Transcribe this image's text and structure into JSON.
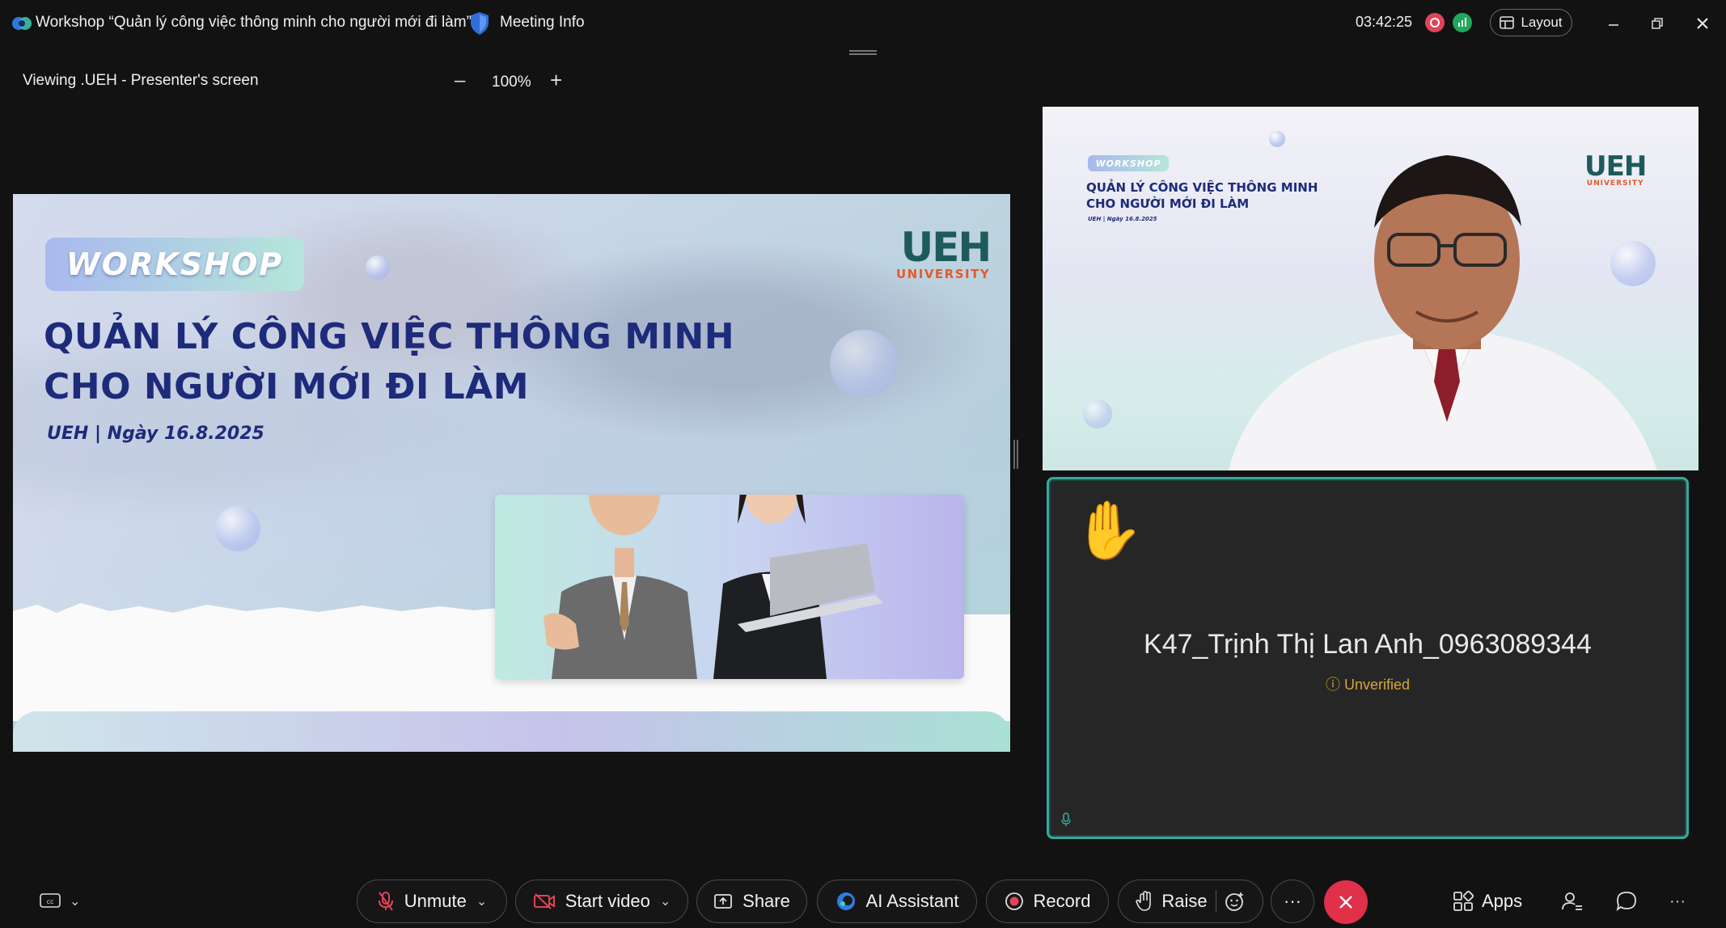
{
  "titlebar": {
    "meeting_title": "Workshop “Quản lý công việc thông minh cho người mới đi làm”",
    "meeting_info_label": "Meeting Info",
    "timer": "03:42:25",
    "layout_label": "Layout"
  },
  "viewbar": {
    "viewing_label": "Viewing .UEH - Presenter's screen",
    "zoom_level": "100%",
    "zoom_out": "–",
    "zoom_in": "+"
  },
  "slide": {
    "tag": "WORKSHOP",
    "title_line1": "QUẢN LÝ CÔNG VIỆC THÔNG MINH",
    "title_line2": "CHO NGƯỜI MỚI ĐI LÀM",
    "date": "UEH | Ngày 16.8.2025",
    "logo_main": "UEH",
    "logo_sub": "UNIVERSITY"
  },
  "webcam": {
    "tag": "WORKSHOP",
    "title_line1": "QUẢN LÝ CÔNG VIỆC THÔNG MINH",
    "title_line2": "CHO NGƯỜI MỚI ĐI LÀM",
    "date": "UEH | Ngày 16.8.2025",
    "logo_main": "UEH",
    "logo_sub": "UNIVERSITY"
  },
  "participant": {
    "name": "K47_Trịnh Thị Lan Anh_0963089344",
    "status": "Unverified",
    "hand_icon": "raised-hand-icon"
  },
  "toolbar": {
    "unmute": "Unmute",
    "start_video": "Start video",
    "share": "Share",
    "ai_assistant": "AI Assistant",
    "record": "Record",
    "raise": "Raise",
    "more": "···",
    "apps": "Apps",
    "overflow": "···"
  },
  "colors": {
    "accent_teal": "#3aa79a",
    "end_call_red": "#e0304a",
    "record_red": "#e0435a",
    "signal_green": "#1fa85a",
    "slide_navy": "#1e2b7a",
    "ueh_orange": "#e65a2a",
    "unverified_amber": "#d8a53a"
  }
}
